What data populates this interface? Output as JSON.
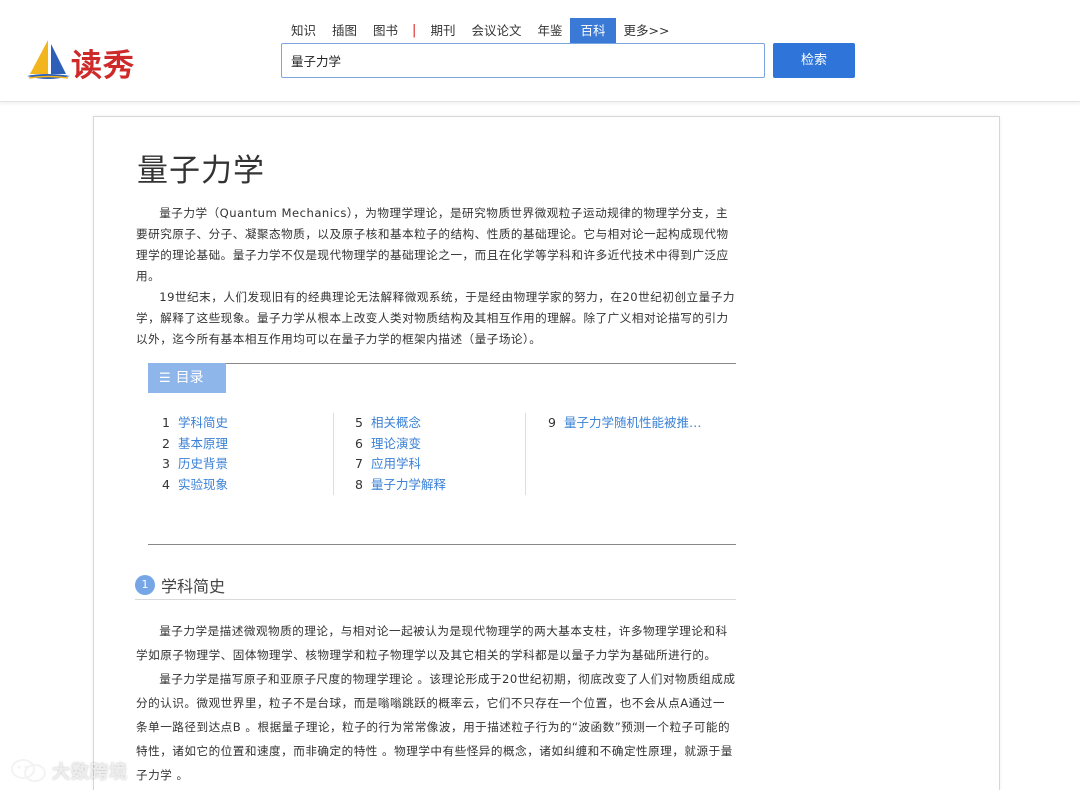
{
  "header": {
    "logo_text": "读秀",
    "nav": [
      {
        "label": "知识",
        "active": false
      },
      {
        "label": "插图",
        "active": false
      },
      {
        "label": "图书",
        "active": false
      },
      {
        "label": "期刊",
        "active": false
      },
      {
        "label": "会议论文",
        "active": false
      },
      {
        "label": "年鉴",
        "active": false
      },
      {
        "label": "百科",
        "active": true
      },
      {
        "label": "更多>>",
        "active": false
      }
    ],
    "nav_separator": "|",
    "search_value": "量子力学",
    "search_button": "检索"
  },
  "article": {
    "title": "量子力学",
    "intro_paragraphs": [
      "量子力学（Quantum Mechanics），为物理学理论，是研究物质世界微观粒子运动规律的物理学分支，主要研究原子、分子、凝聚态物质，以及原子核和基本粒子的结构、性质的基础理论。它与相对论一起构成现代物理学的理论基础。量子力学不仅是现代物理学的基础理论之一，而且在化学等学科和许多近代技术中得到广泛应用。",
      "19世纪末，人们发现旧有的经典理论无法解释微观系统，于是经由物理学家的努力，在20世纪初创立量子力学，解释了这些现象。量子力学从根本上改变人类对物质结构及其相互作用的理解。除了广义相对论描写的引力以外，迄今所有基本相互作用均可以在量子力学的框架内描述（量子场论）。"
    ],
    "toc": {
      "label": "目录",
      "icon": "list-icon",
      "columns": [
        [
          {
            "num": "1",
            "label": "学科简史"
          },
          {
            "num": "2",
            "label": "基本原理"
          },
          {
            "num": "3",
            "label": "历史背景"
          },
          {
            "num": "4",
            "label": "实验现象"
          }
        ],
        [
          {
            "num": "5",
            "label": "相关概念"
          },
          {
            "num": "6",
            "label": "理论演变"
          },
          {
            "num": "7",
            "label": "应用学科"
          },
          {
            "num": "8",
            "label": "量子力学解释"
          }
        ],
        [
          {
            "num": "9",
            "label": "量子力学随机性能被推…"
          }
        ]
      ]
    },
    "section": {
      "number": "1",
      "title": "学科简史",
      "paragraphs": [
        "量子力学是描述微观物质的理论，与相对论一起被认为是现代物理学的两大基本支柱，许多物理学理论和科学如原子物理学、固体物理学、核物理学和粒子物理学以及其它相关的学科都是以量子力学为基础所进行的。",
        "量子力学是描写原子和亚原子尺度的物理学理论 。该理论形成于20世纪初期，彻底改变了人们对物质组成成分的认识。微观世界里，粒子不是台球，而是嗡嗡跳跃的概率云，它们不只存在一个位置，也不会从点A通过一条单一路径到达点B 。根据量子理论，粒子的行为常常像波，用于描述粒子行为的“波函数”预测一个粒子可能的特性，诸如它的位置和速度，而非确定的特性 。物理学中有些怪异的概念，诸如纠缠和不确定性原理，就源于量子力学 。"
      ]
    }
  },
  "watermark": {
    "text": "大数跨境",
    "icon": "wechat-logo-icon"
  },
  "colors": {
    "accent": "#2e74d9",
    "nav_active": "#3a7ad6",
    "link": "#3b82d6",
    "toc_tab": "#8fb6ea",
    "logo_red": "#cf2a2a"
  }
}
